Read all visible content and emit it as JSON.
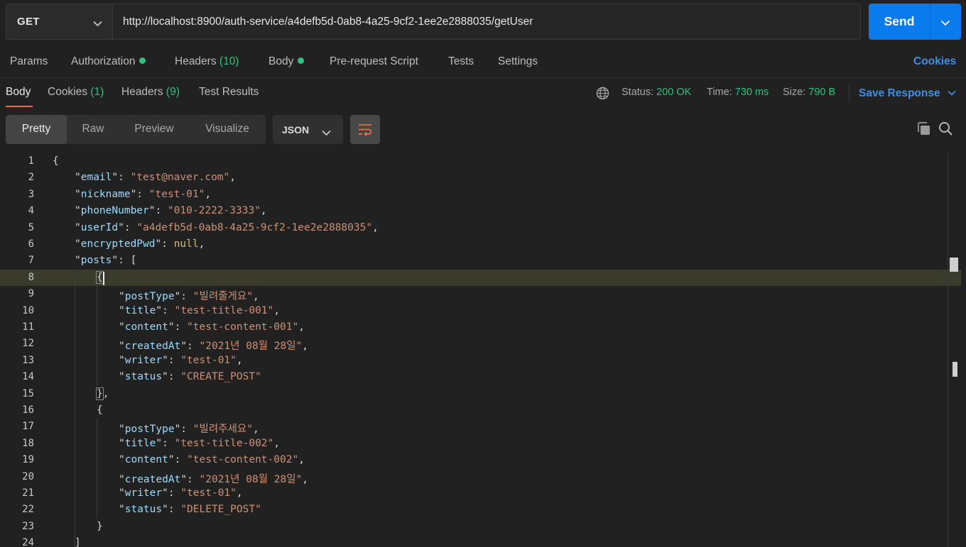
{
  "request": {
    "method": "GET",
    "url": "http://localhost:8900/auth-service/a4defb5d-0ab8-4a25-9cf2-1ee2e2888035/getUser",
    "send_label": "Send"
  },
  "request_tabs": {
    "params": "Params",
    "authorization": "Authorization",
    "headers": "Headers",
    "headers_count": "(10)",
    "body": "Body",
    "prerequest": "Pre-request Script",
    "tests": "Tests",
    "settings": "Settings",
    "cookies": "Cookies"
  },
  "response_tabs": {
    "body": "Body",
    "cookies": "Cookies",
    "cookies_count": "(1)",
    "headers": "Headers",
    "headers_count": "(9)",
    "test_results": "Test Results"
  },
  "response_meta": {
    "status_label": "Status:",
    "status_value": "200 OK",
    "time_label": "Time:",
    "time_value": "730 ms",
    "size_label": "Size:",
    "size_value": "790 B",
    "save_response": "Save Response"
  },
  "view": {
    "modes": [
      "Pretty",
      "Raw",
      "Preview",
      "Visualize"
    ],
    "active_mode": "Pretty",
    "format": "JSON"
  },
  "code_lines": [
    {
      "n": "1",
      "indent": 0,
      "parts": [
        [
          "p",
          "{"
        ]
      ]
    },
    {
      "n": "2",
      "indent": 1,
      "parts": [
        [
          "p",
          "\""
        ],
        [
          "k",
          "email"
        ],
        [
          "p",
          "\": "
        ],
        [
          "s",
          "\"test@naver.com\""
        ],
        [
          "p",
          ","
        ]
      ]
    },
    {
      "n": "3",
      "indent": 1,
      "parts": [
        [
          "p",
          "\""
        ],
        [
          "k",
          "nickname"
        ],
        [
          "p",
          "\": "
        ],
        [
          "s",
          "\"test-01\""
        ],
        [
          "p",
          ","
        ]
      ]
    },
    {
      "n": "4",
      "indent": 1,
      "parts": [
        [
          "p",
          "\""
        ],
        [
          "k",
          "phoneNumber"
        ],
        [
          "p",
          "\": "
        ],
        [
          "s",
          "\"010-2222-3333\""
        ],
        [
          "p",
          ","
        ]
      ]
    },
    {
      "n": "5",
      "indent": 1,
      "parts": [
        [
          "p",
          "\""
        ],
        [
          "k",
          "userId"
        ],
        [
          "p",
          "\": "
        ],
        [
          "s",
          "\"a4defb5d-0ab8-4a25-9cf2-1ee2e2888035\""
        ],
        [
          "p",
          ","
        ]
      ]
    },
    {
      "n": "6",
      "indent": 1,
      "parts": [
        [
          "p",
          "\""
        ],
        [
          "k",
          "encryptedPwd"
        ],
        [
          "p",
          "\": "
        ],
        [
          "n",
          "null"
        ],
        [
          "p",
          ","
        ]
      ]
    },
    {
      "n": "7",
      "indent": 1,
      "parts": [
        [
          "p",
          "\""
        ],
        [
          "k",
          "posts"
        ],
        [
          "p",
          "\": ["
        ]
      ]
    },
    {
      "n": "8",
      "indent": 2,
      "parts": [
        [
          "b",
          "{"
        ]
      ]
    },
    {
      "n": "9",
      "indent": 3,
      "parts": [
        [
          "p",
          "\""
        ],
        [
          "k",
          "postType"
        ],
        [
          "p",
          "\": "
        ],
        [
          "s",
          "\"빌려줄게요\""
        ],
        [
          "p",
          ","
        ]
      ]
    },
    {
      "n": "10",
      "indent": 3,
      "parts": [
        [
          "p",
          "\""
        ],
        [
          "k",
          "title"
        ],
        [
          "p",
          "\": "
        ],
        [
          "s",
          "\"test-title-001\""
        ],
        [
          "p",
          ","
        ]
      ]
    },
    {
      "n": "11",
      "indent": 3,
      "parts": [
        [
          "p",
          "\""
        ],
        [
          "k",
          "content"
        ],
        [
          "p",
          "\": "
        ],
        [
          "s",
          "\"test-content-001\""
        ],
        [
          "p",
          ","
        ]
      ]
    },
    {
      "n": "12",
      "indent": 3,
      "parts": [
        [
          "p",
          "\""
        ],
        [
          "k",
          "createdAt"
        ],
        [
          "p",
          "\": "
        ],
        [
          "s",
          "\"2021년 08월 28일\""
        ],
        [
          "p",
          ","
        ]
      ]
    },
    {
      "n": "13",
      "indent": 3,
      "parts": [
        [
          "p",
          "\""
        ],
        [
          "k",
          "writer"
        ],
        [
          "p",
          "\": "
        ],
        [
          "s",
          "\"test-01\""
        ],
        [
          "p",
          ","
        ]
      ]
    },
    {
      "n": "14",
      "indent": 3,
      "parts": [
        [
          "p",
          "\""
        ],
        [
          "k",
          "status"
        ],
        [
          "p",
          "\": "
        ],
        [
          "s",
          "\"CREATE_POST\""
        ]
      ]
    },
    {
      "n": "15",
      "indent": 2,
      "parts": [
        [
          "b",
          "}"
        ],
        [
          "p",
          ","
        ]
      ]
    },
    {
      "n": "16",
      "indent": 2,
      "parts": [
        [
          "p",
          "{"
        ]
      ]
    },
    {
      "n": "17",
      "indent": 3,
      "parts": [
        [
          "p",
          "\""
        ],
        [
          "k",
          "postType"
        ],
        [
          "p",
          "\": "
        ],
        [
          "s",
          "\"빌려주세요\""
        ],
        [
          "p",
          ","
        ]
      ]
    },
    {
      "n": "18",
      "indent": 3,
      "parts": [
        [
          "p",
          "\""
        ],
        [
          "k",
          "title"
        ],
        [
          "p",
          "\": "
        ],
        [
          "s",
          "\"test-title-002\""
        ],
        [
          "p",
          ","
        ]
      ]
    },
    {
      "n": "19",
      "indent": 3,
      "parts": [
        [
          "p",
          "\""
        ],
        [
          "k",
          "content"
        ],
        [
          "p",
          "\": "
        ],
        [
          "s",
          "\"test-content-002\""
        ],
        [
          "p",
          ","
        ]
      ]
    },
    {
      "n": "20",
      "indent": 3,
      "parts": [
        [
          "p",
          "\""
        ],
        [
          "k",
          "createdAt"
        ],
        [
          "p",
          "\": "
        ],
        [
          "s",
          "\"2021년 08월 28일\""
        ],
        [
          "p",
          ","
        ]
      ]
    },
    {
      "n": "21",
      "indent": 3,
      "parts": [
        [
          "p",
          "\""
        ],
        [
          "k",
          "writer"
        ],
        [
          "p",
          "\": "
        ],
        [
          "s",
          "\"test-01\""
        ],
        [
          "p",
          ","
        ]
      ]
    },
    {
      "n": "22",
      "indent": 3,
      "parts": [
        [
          "p",
          "\""
        ],
        [
          "k",
          "status"
        ],
        [
          "p",
          "\": "
        ],
        [
          "s",
          "\"DELETE_POST\""
        ]
      ]
    },
    {
      "n": "23",
      "indent": 2,
      "parts": [
        [
          "p",
          "}"
        ]
      ]
    },
    {
      "n": "24",
      "indent": 1,
      "parts": [
        [
          "p",
          "]"
        ]
      ]
    }
  ],
  "highlighted_line": "8",
  "icons": {
    "method_chevron": "chevron-down-icon",
    "send_chevron": "chevron-down-icon",
    "status_globe": "globe-icon",
    "save_chevron": "chevron-down-icon",
    "wrap": "word-wrap-icon",
    "copy": "copy-icon",
    "search": "search-icon"
  },
  "colors": {
    "background": "#212121",
    "accent_blue": "#097bed",
    "link_blue": "#3d91e8",
    "status_green": "#2ec27e",
    "active_tab_underline": "#f26b3a",
    "json_key": "#9cdcfe",
    "json_string": "#ce9178"
  }
}
